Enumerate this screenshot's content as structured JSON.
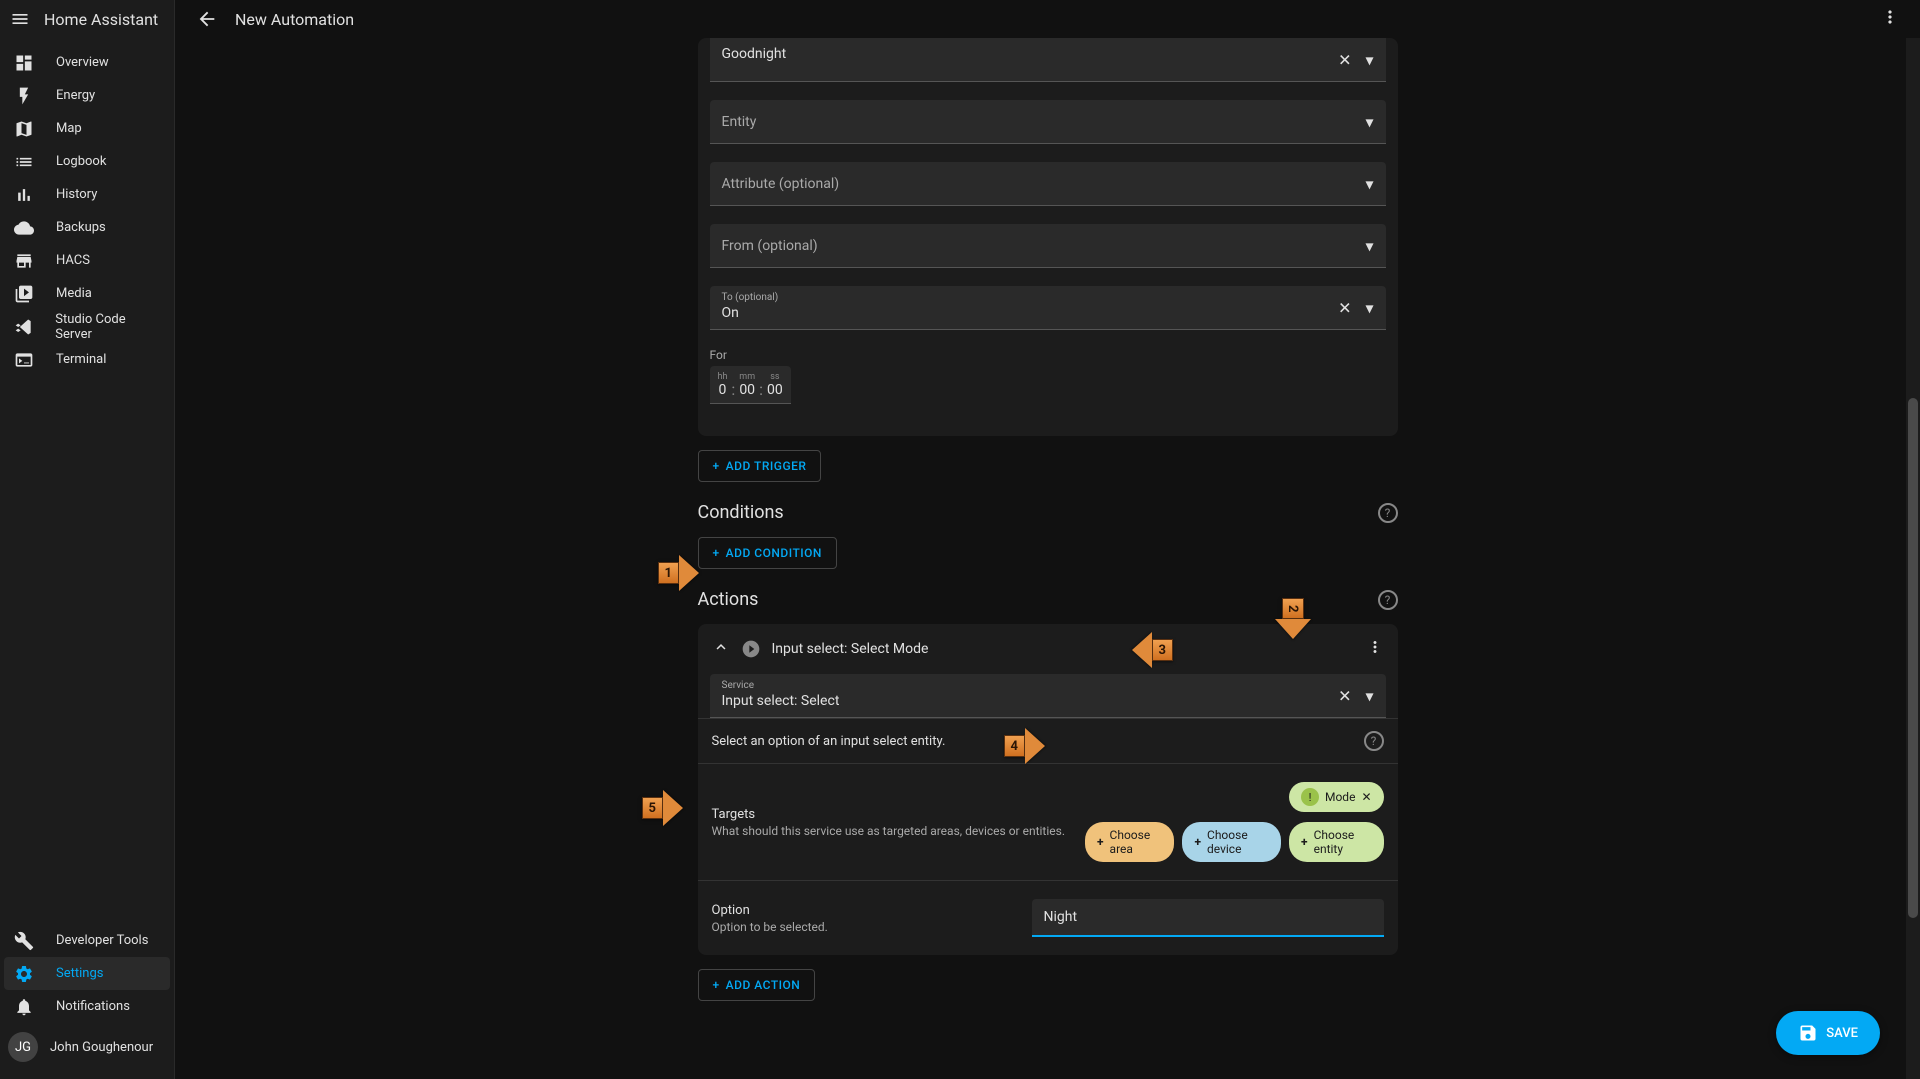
{
  "app_title": "Home Assistant",
  "page_title": "New Automation",
  "sidebar": {
    "items": [
      {
        "label": "Overview"
      },
      {
        "label": "Energy"
      },
      {
        "label": "Map"
      },
      {
        "label": "Logbook"
      },
      {
        "label": "History"
      },
      {
        "label": "Backups"
      },
      {
        "label": "HACS"
      },
      {
        "label": "Media"
      },
      {
        "label": "Studio Code Server"
      },
      {
        "label": "Terminal"
      }
    ],
    "bottom": [
      {
        "label": "Developer Tools"
      },
      {
        "label": "Settings"
      },
      {
        "label": "Notifications"
      }
    ],
    "user": {
      "initials": "JG",
      "name": "John Goughenour"
    }
  },
  "trigger": {
    "goodnight_value": "Goodnight",
    "entity_label": "Entity",
    "attribute_label": "Attribute (optional)",
    "from_label": "From (optional)",
    "to_label": "To (optional)",
    "to_value": "On",
    "for_label": "For",
    "hh_label": "hh",
    "hh_value": "0",
    "mm_label": "mm",
    "mm_value": "00",
    "ss_label": "ss",
    "ss_value": "00",
    "add_trigger": "ADD TRIGGER"
  },
  "conditions": {
    "title": "Conditions",
    "add_condition": "ADD CONDITION"
  },
  "actions": {
    "title": "Actions",
    "header": "Input select: Select Mode",
    "service_label": "Service",
    "service_value": "Input select: Select",
    "service_desc": "Select an option of an input select entity.",
    "targets_title": "Targets",
    "targets_sub": "What should this service use as targeted areas, devices or entities.",
    "mode_chip": "Mode",
    "choose_area": "Choose area",
    "choose_device": "Choose device",
    "choose_entity": "Choose entity",
    "option_title": "Option",
    "option_sub": "Option to be selected.",
    "option_value": "Night",
    "add_action": "ADD ACTION"
  },
  "save_label": "SAVE",
  "annotations": {
    "a1": "1",
    "a2": "2",
    "a3": "3",
    "a4": "4",
    "a5": "5"
  }
}
